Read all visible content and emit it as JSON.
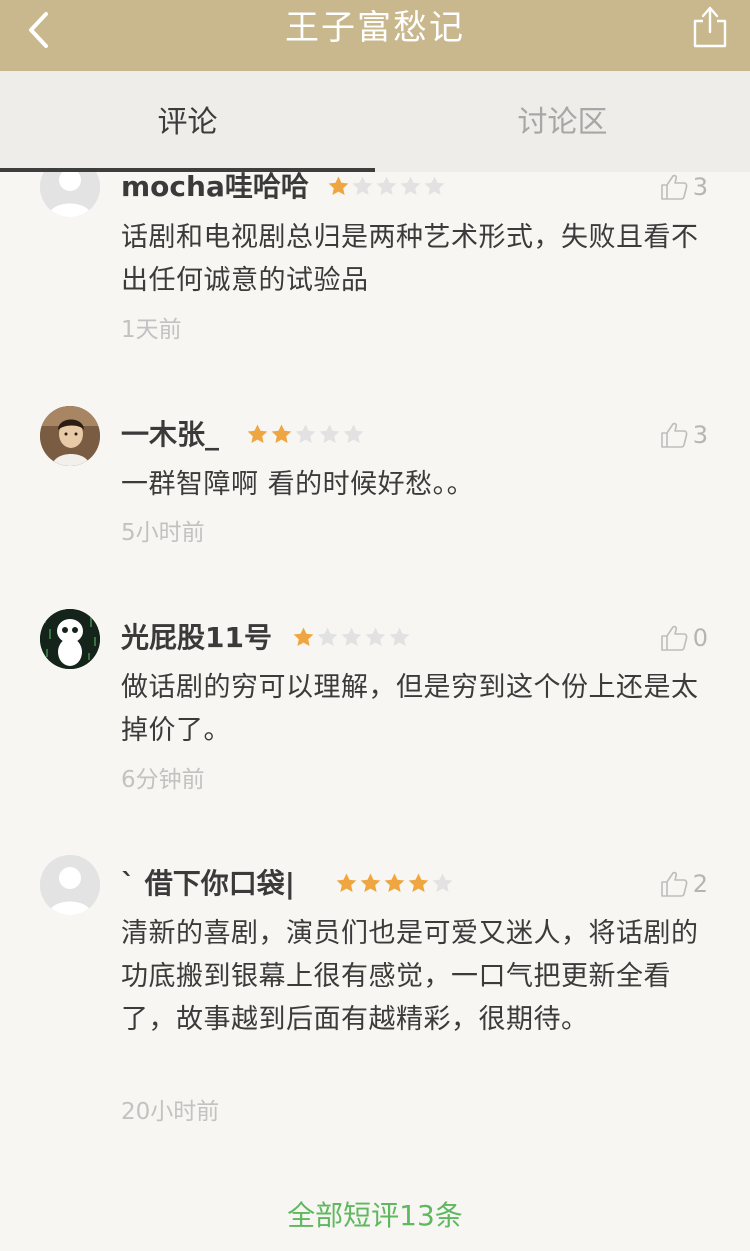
{
  "header": {
    "title": "王子富愁记",
    "bg_color": "#c9b88e",
    "back_icon": "chevron-left-icon",
    "share_icon": "share-icon"
  },
  "tabs": [
    {
      "label": "评论",
      "active": true
    },
    {
      "label": "讨论区",
      "active": false
    }
  ],
  "reviews": [
    {
      "user": "mocha哇哈哈",
      "rating": 1,
      "likes": "3",
      "text": "话剧和电视剧总归是两种艺术形式，失败且看不出任何诚意的试验品",
      "time": "1天前",
      "avatar": "default-avatar"
    },
    {
      "user": "一木张_",
      "rating": 2,
      "likes": "3",
      "text": "一群智障啊 看的时候好愁。。",
      "time": "5小时前",
      "avatar": "photo-avatar"
    },
    {
      "user": "光屁股11号",
      "rating": 1,
      "likes": "0",
      "text": "做话剧的穷可以理解，但是穷到这个份上还是太掉价了。",
      "time": "6分钟前",
      "avatar": "cartoon-avatar"
    },
    {
      "user": "ˋ 借下你口袋|",
      "rating": 4,
      "likes": "2",
      "text": "清新的喜剧，演员们也是可爱又迷人，将话剧的功底搬到银幕上很有感觉，一口气把更新全看了，故事越到后面有越精彩，很期待。",
      "time": "20小时前",
      "avatar": "default-avatar"
    }
  ],
  "footer": {
    "all_reviews_label": "全部短评13条",
    "link_color": "#5fb85f"
  },
  "colors": {
    "star_filled": "#f0a640",
    "star_empty": "#e2e2e2"
  }
}
